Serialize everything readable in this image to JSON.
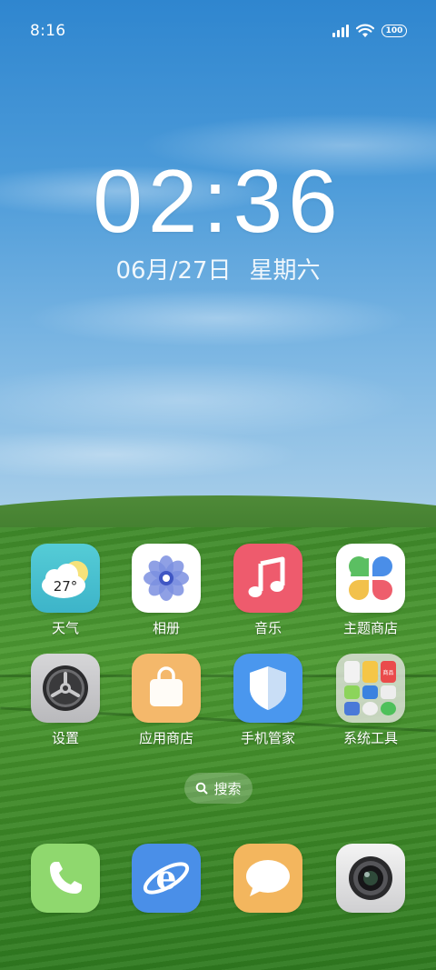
{
  "status_bar": {
    "time": "8:16",
    "battery": "100"
  },
  "clock": {
    "time": "02:36",
    "date": "06月/27日",
    "weekday": "星期六"
  },
  "apps": {
    "weather": {
      "label": "天气",
      "temperature": "27°"
    },
    "gallery": {
      "label": "相册"
    },
    "music": {
      "label": "音乐"
    },
    "theme_store": {
      "label": "主题商店"
    },
    "settings": {
      "label": "设置"
    },
    "app_store": {
      "label": "应用商店"
    },
    "phone_manager": {
      "label": "手机管家"
    },
    "system_tools": {
      "label": "系统工具",
      "folder_badge": "商品"
    }
  },
  "search": {
    "label": "搜索"
  },
  "dock": {
    "items": [
      "phone-icon",
      "browser-icon",
      "messages-icon",
      "camera-icon"
    ]
  },
  "colors": {
    "weather_bg": "#49c1d1",
    "music_bg": "#ee5b6d",
    "app_store_bg": "#f4b86b",
    "phone_manager_bg": "#4a97ee",
    "phone_bg": "#8fd86e",
    "browser_bg": "#4a8fe8",
    "messages_bg": "#f3b65e"
  }
}
